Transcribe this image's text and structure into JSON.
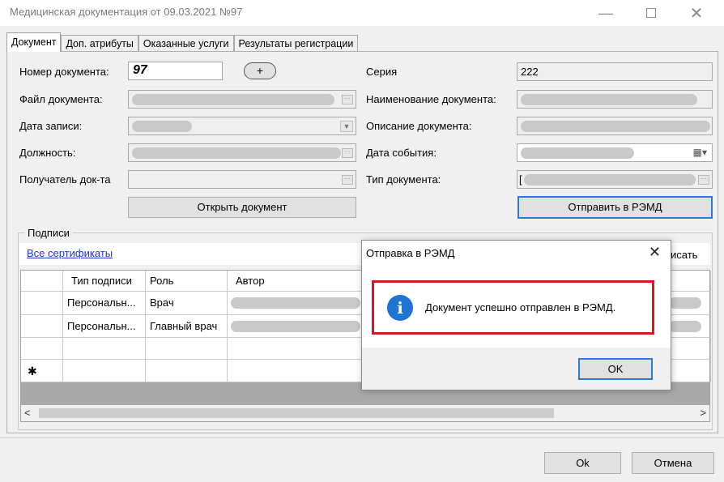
{
  "window": {
    "title": "Медицинская документация от 09.03.2021 №97"
  },
  "tabs": [
    "Документ",
    "Доп. атрибуты",
    "Оказанные услуги",
    "Результаты регистрации"
  ],
  "form": {
    "doc_number_label": "Номер документа:",
    "doc_number_value": "97",
    "add_label": "+",
    "doc_file_label": "Файл документа:",
    "record_date_label": "Дата записи:",
    "position_label": "Должность:",
    "recipient_label": "Получатель док-та",
    "open_doc_label": "Открыть документ",
    "series_label": "Серия",
    "series_value": "222",
    "doc_name_label": "Наименование документа:",
    "doc_desc_label": "Описание документа:",
    "event_date_label": "Дата события:",
    "doc_type_label": "Тип документа:",
    "doc_type_value_prefix": "[",
    "send_remd_label": "Отправить в РЭМД"
  },
  "signatures": {
    "group_label": "Подписи",
    "all_certs_link": "Все сертификаты",
    "sign_label_partial": "исать",
    "columns": [
      "Тип подписи",
      "Роль",
      "Автор"
    ],
    "rows": [
      {
        "type": "Персональн...",
        "role": "Врач"
      },
      {
        "type": "Персональн...",
        "role": "Главный врач"
      }
    ],
    "new_row_marker": "✱"
  },
  "dialog": {
    "title": "Отправка в РЭМД",
    "message": "Документ успешно отправлен в РЭМД.",
    "ok_label": "OK",
    "icon": "info-icon",
    "highlight_color": "#e0141b"
  },
  "footer": {
    "ok_label": "Ok",
    "cancel_label": "Отмена"
  },
  "colors": {
    "accent": "#2c7ad6",
    "link": "#1a3cc8",
    "info": "#1f74d1"
  }
}
